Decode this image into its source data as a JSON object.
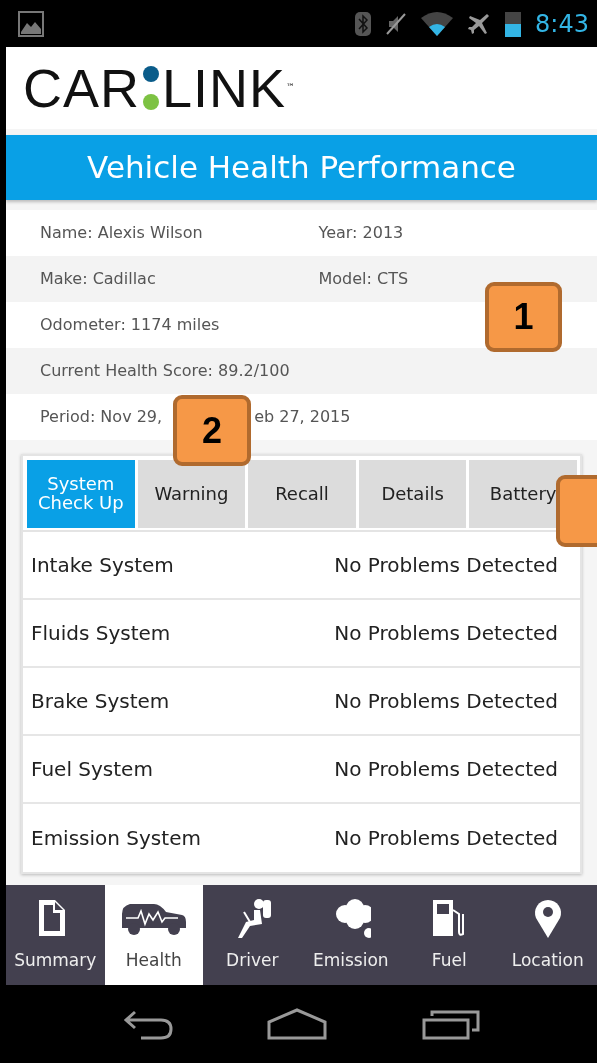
{
  "status_bar": {
    "time": "8:43"
  },
  "logo": {
    "left": "CAR",
    "right": "LINK",
    "trademark": "™"
  },
  "title": "Vehicle Health Performance",
  "info_rows": [
    {
      "kind": "pair",
      "cells": [
        "Name: Alexis Wilson",
        "Year: 2013"
      ]
    },
    {
      "kind": "pair",
      "cells": [
        "Make: Cadillac",
        "Model: CTS"
      ]
    },
    {
      "kind": "single",
      "cells": [
        "Odometer: 1174 miles"
      ]
    },
    {
      "kind": "single",
      "cells": [
        "Current Health Score: 89.2/100"
      ]
    },
    {
      "kind": "covered",
      "cells": [
        "Period: Nov 29,",
        "eb 27, 2015"
      ]
    }
  ],
  "tabs": [
    {
      "label": "System Check Up",
      "selected": true
    },
    {
      "label": "Warning",
      "selected": false
    },
    {
      "label": "Recall",
      "selected": false
    },
    {
      "label": "Details",
      "selected": false
    },
    {
      "label": "Battery",
      "selected": false
    }
  ],
  "systems": [
    {
      "name": "Intake System",
      "status": "No Problems Detected"
    },
    {
      "name": "Fluids System",
      "status": "No Problems Detected"
    },
    {
      "name": "Brake System",
      "status": "No Problems Detected"
    },
    {
      "name": "Fuel System",
      "status": "No Problems Detected"
    },
    {
      "name": "Emission System",
      "status": "No Problems Detected"
    }
  ],
  "bottom_nav": [
    {
      "label": "Summary",
      "selected": false
    },
    {
      "label": "Health",
      "selected": true
    },
    {
      "label": "Driver",
      "selected": false
    },
    {
      "label": "Emission",
      "selected": false
    },
    {
      "label": "Fuel",
      "selected": false
    },
    {
      "label": "Location",
      "selected": false
    }
  ],
  "callouts": [
    "1",
    "2"
  ]
}
